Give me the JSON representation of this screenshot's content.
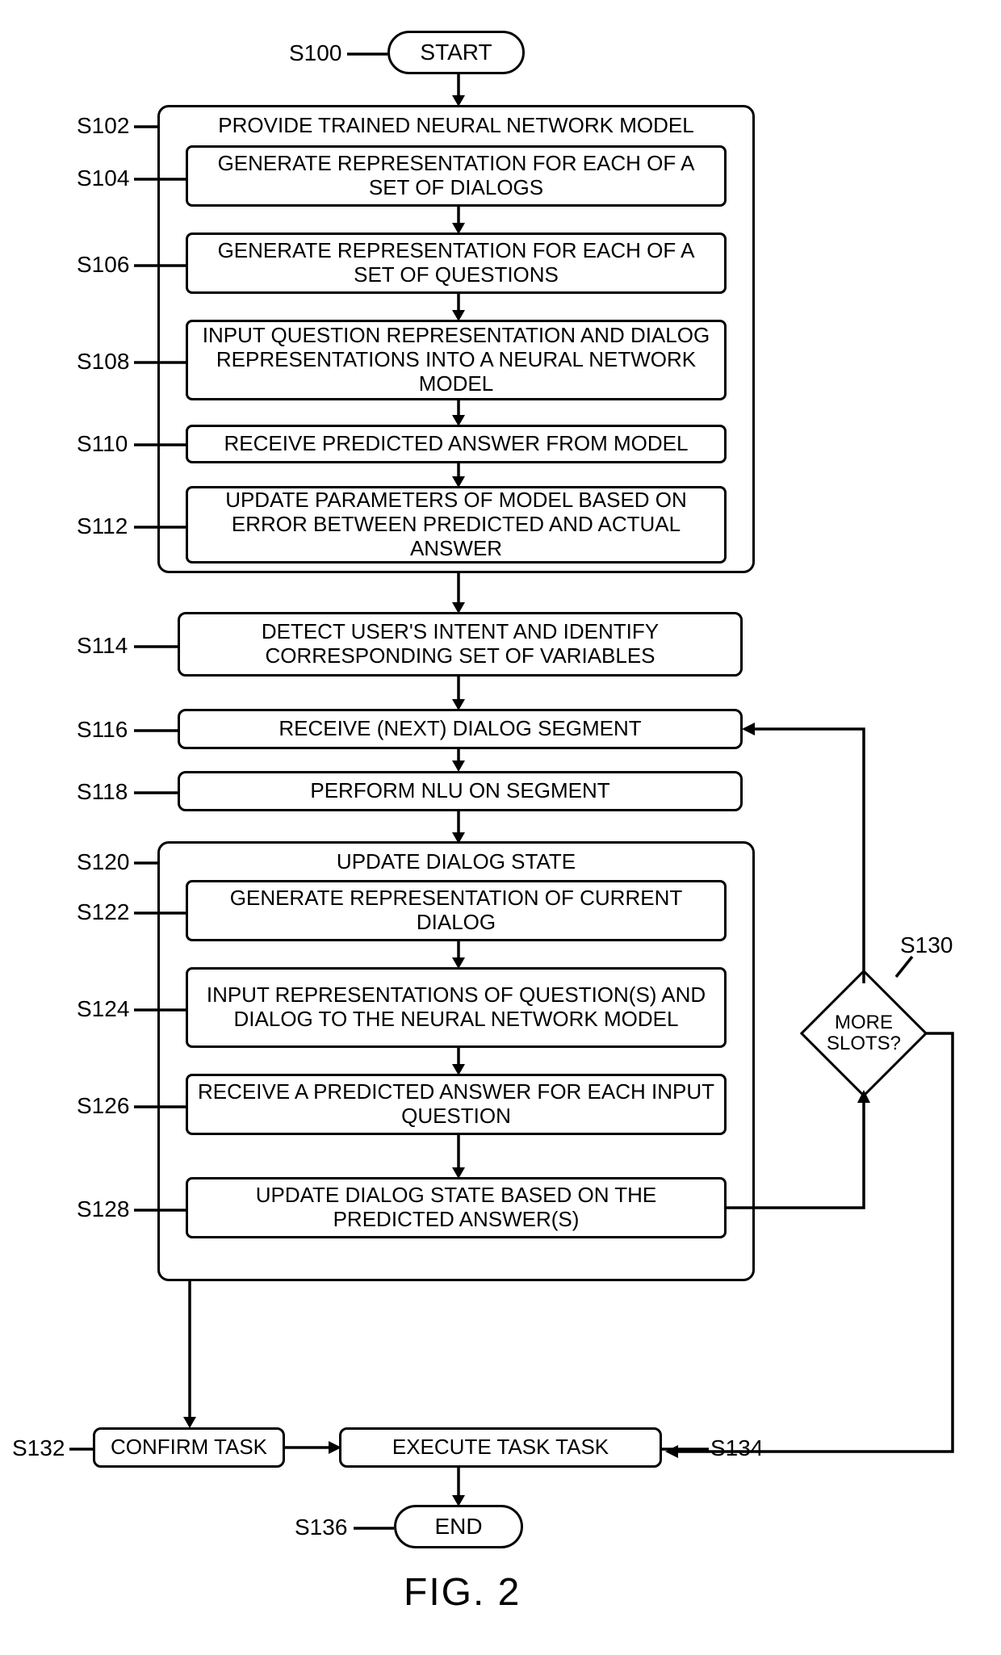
{
  "terminals": {
    "start": "START",
    "end": "END"
  },
  "labels": {
    "s100": "S100",
    "s102": "S102",
    "s104": "S104",
    "s106": "S106",
    "s108": "S108",
    "s110": "S110",
    "s112": "S112",
    "s114": "S114",
    "s116": "S116",
    "s118": "S118",
    "s120": "S120",
    "s122": "S122",
    "s124": "S124",
    "s126": "S126",
    "s128": "S128",
    "s130": "S130",
    "s132": "S132",
    "s134": "S134",
    "s136": "S136"
  },
  "group1": {
    "title": "PROVIDE TRAINED NEURAL NETWORK MODEL",
    "s104": "GENERATE REPRESENTATION FOR EACH OF A SET OF DIALOGS",
    "s106": "GENERATE REPRESENTATION FOR EACH OF A SET OF QUESTIONS",
    "s108": "INPUT QUESTION REPRESENTATION AND DIALOG REPRESENTATIONS INTO A NEURAL NETWORK MODEL",
    "s110": "RECEIVE PREDICTED ANSWER FROM MODEL",
    "s112": "UPDATE PARAMETERS OF MODEL BASED ON ERROR BETWEEN PREDICTED AND ACTUAL ANSWER"
  },
  "steps": {
    "s114": "DETECT USER'S INTENT AND IDENTIFY CORRESPONDING SET OF VARIABLES",
    "s116": "RECEIVE (NEXT) DIALOG SEGMENT",
    "s118": "PERFORM NLU ON SEGMENT"
  },
  "group2": {
    "title": "UPDATE DIALOG STATE",
    "s122": "GENERATE REPRESENTATION OF CURRENT DIALOG",
    "s124": "INPUT REPRESENTATIONS OF QUESTION(S) AND DIALOG TO THE NEURAL NETWORK MODEL",
    "s126": "RECEIVE A PREDICTED ANSWER FOR EACH INPUT QUESTION",
    "s128": "UPDATE DIALOG STATE BASED ON THE PREDICTED ANSWER(S)"
  },
  "decision": {
    "s130": "MORE SLOTS?"
  },
  "bottom": {
    "s132": "CONFIRM TASK",
    "s134": "EXECUTE TASK TASK"
  },
  "figure": "FIG. 2"
}
